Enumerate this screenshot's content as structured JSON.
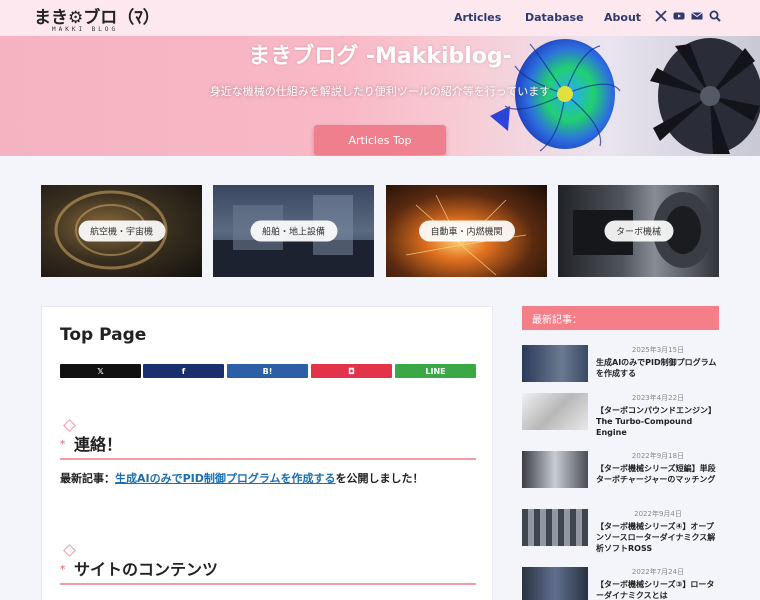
{
  "header": {
    "logo_text": "まき⚙ブロ（ﾏ）",
    "logo_sub": "MAKKI BLOG",
    "nav": [
      {
        "label": "Articles"
      },
      {
        "label": "Database"
      },
      {
        "label": "About"
      }
    ],
    "icons": [
      "x-icon",
      "youtube-icon",
      "mail-icon",
      "search-icon"
    ]
  },
  "hero": {
    "title": "まきブログ -Makkiblog-",
    "subtitle": "身近な機械の仕組みを解説したり便利ツールの紹介等を行っています",
    "button_label": "Articles Top"
  },
  "categories": [
    {
      "label": "航空機・宇宙機"
    },
    {
      "label": "船舶・地上設備"
    },
    {
      "label": "自動車・内燃機関"
    },
    {
      "label": "ターボ機械"
    }
  ],
  "main": {
    "page_title": "Top Page",
    "share_buttons": [
      {
        "label": "𝕏",
        "color": "#111111"
      },
      {
        "label": "f",
        "color": "#1b2f6e"
      },
      {
        "label": "B!",
        "color": "#2c5fa6"
      },
      {
        "label": "◘",
        "color": "#e3334a"
      },
      {
        "label": "LINE",
        "color": "#3aa845"
      }
    ],
    "section1_heading": "連絡！",
    "notice_prefix": "最新記事：",
    "notice_link": "生成AIのみでPID制御プログラムを作成する",
    "notice_suffix": "を公開しました！",
    "section2_heading": "サイトのコンテンツ"
  },
  "sidebar": {
    "heading": "最新記事：",
    "posts": [
      {
        "date": "2025年3月15日",
        "title": "生成AIのみでPID制御プログラムを作成する"
      },
      {
        "date": "2023年4月22日",
        "title": "【ターボコンパウンドエンジン】The Turbo-Compound Engine"
      },
      {
        "date": "2022年9月18日",
        "title": "【ターボ機械シリーズ短編】単段ターボチャージャーのマッチング"
      },
      {
        "date": "2022年9月4日",
        "title": "【ターボ機械シリーズ④】オープンソースローターダイナミクス解析ソフトROSS"
      },
      {
        "date": "2022年7月24日",
        "title": "【ターボ機械シリーズ③】ローターダイナミクスとは"
      }
    ]
  }
}
